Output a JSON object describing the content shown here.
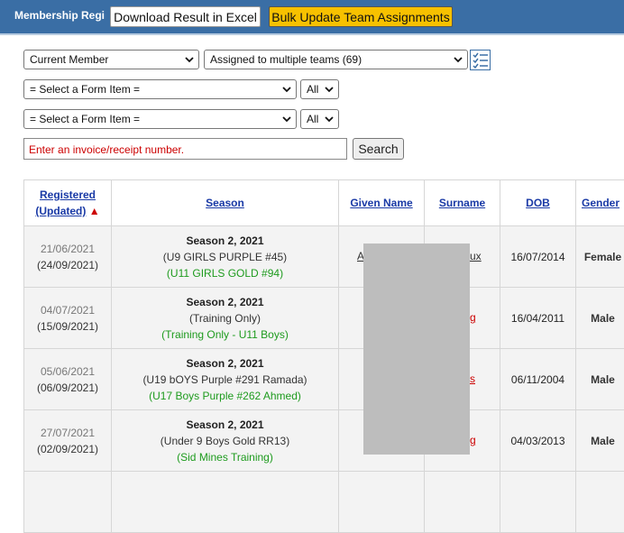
{
  "header": {
    "app_title": "Membership Regi",
    "download_button": "Download Result in Excel",
    "bulk_button": "Bulk Update Team Assignments"
  },
  "filters": {
    "member_select": "Current Member",
    "teams_select": "Assigned to multiple teams (69)",
    "form_item_1": "= Select a Form Item =",
    "form_item_2": "= Select a Form Item =",
    "all_1": "All",
    "all_2": "All",
    "invoice_placeholder": "Enter an invoice/receipt number.",
    "search_button": "Search"
  },
  "table": {
    "headers": {
      "registered": "Registered",
      "updated": "(Updated)",
      "sort_indicator": "▲",
      "season": "Season",
      "given_name": "Given Name",
      "surname": "Surname",
      "dob": "DOB",
      "gender": "Gender"
    },
    "rows": [
      {
        "registered": "21/06/2021",
        "updated": "(24/09/2021)",
        "season": "Season 2, 2021",
        "team": "(U9 GIRLS PURPLE #45)",
        "assignment": "(U11 GIRLS GOLD #94)",
        "given_fragment": "A",
        "surname_fragment": "ux",
        "dob": "16/07/2014",
        "gender": "Female"
      },
      {
        "registered": "04/07/2021",
        "updated": "(15/09/2021)",
        "season": "Season 2, 2021",
        "team": "(Training Only)",
        "assignment": "(Training Only - U11 Boys)",
        "given_fragment": "",
        "surname_fragment": "g",
        "dob": "16/04/2011",
        "gender": "Male"
      },
      {
        "registered": "05/06/2021",
        "updated": "(06/09/2021)",
        "season": "Season 2, 2021",
        "team": "(U19 bOYS Purple #291 Ramada)",
        "assignment": "(U17 Boys Purple #262 Ahmed)",
        "given_fragment": "",
        "surname_fragment": "s",
        "dob": "06/11/2004",
        "gender": "Male"
      },
      {
        "registered": "27/07/2021",
        "updated": "(02/09/2021)",
        "season": "Season 2, 2021",
        "team": "(Under 9 Boys Gold RR13)",
        "assignment": "(Sid Mines Training)",
        "given_fragment": "",
        "surname_fragment": "g",
        "dob": "04/03/2013",
        "gender": "Male"
      }
    ]
  },
  "icons": {
    "chevron": "chevron-down-icon",
    "column_picker": "column-list-icon"
  }
}
